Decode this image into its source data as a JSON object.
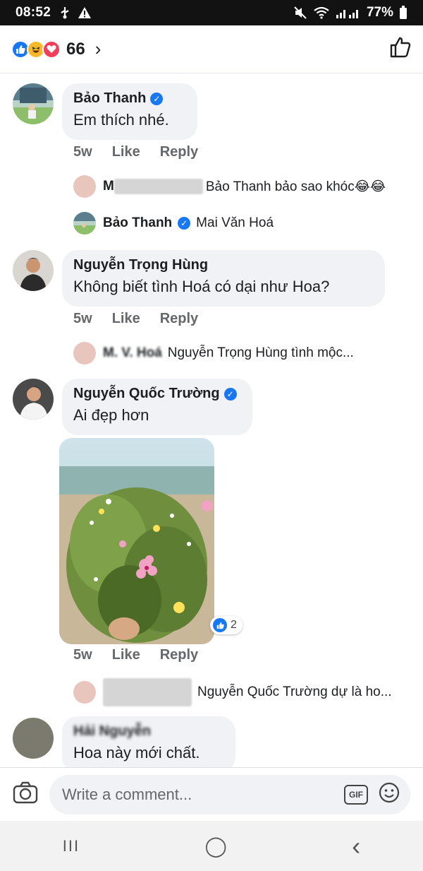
{
  "status_bar": {
    "time": "08:52",
    "battery": "77%"
  },
  "header": {
    "reaction_count": "66",
    "chevron": "›"
  },
  "comments": [
    {
      "author": "Bảo Thanh",
      "text": "Em thích nhé.",
      "time": "5w",
      "like": "Like",
      "reply": "Reply",
      "replies": [
        {
          "name_visible": "M",
          "text": "Bảo Thanh bảo sao khóc😂😂"
        },
        {
          "name": "Bảo Thanh",
          "text": "Mai Văn Hoá"
        }
      ]
    },
    {
      "author": "Nguyễn Trọng Hùng",
      "text": "Không biết tình Hoá có dại như Hoa?",
      "time": "5w",
      "like": "Like",
      "reply": "Reply",
      "replies": [
        {
          "name_visible": "M. V. Hoá",
          "text": "Nguyễn Trọng Hùng tình mộc..."
        }
      ]
    },
    {
      "author": "Nguyễn Quốc Trường",
      "text": "Ai đẹp hơn",
      "photo_reaction_count": "2",
      "time": "5w",
      "like": "Like",
      "reply": "Reply",
      "replies": [
        {
          "text": "Nguyễn Quốc Trường dự là ho..."
        }
      ]
    },
    {
      "author": "Hải Nguyễn",
      "text": "Hoa này mới chất."
    }
  ],
  "composer": {
    "placeholder": "Write a comment...",
    "gif_label": "GIF"
  },
  "navbar": {
    "recent": "III",
    "home": "◯",
    "back": "‹"
  }
}
